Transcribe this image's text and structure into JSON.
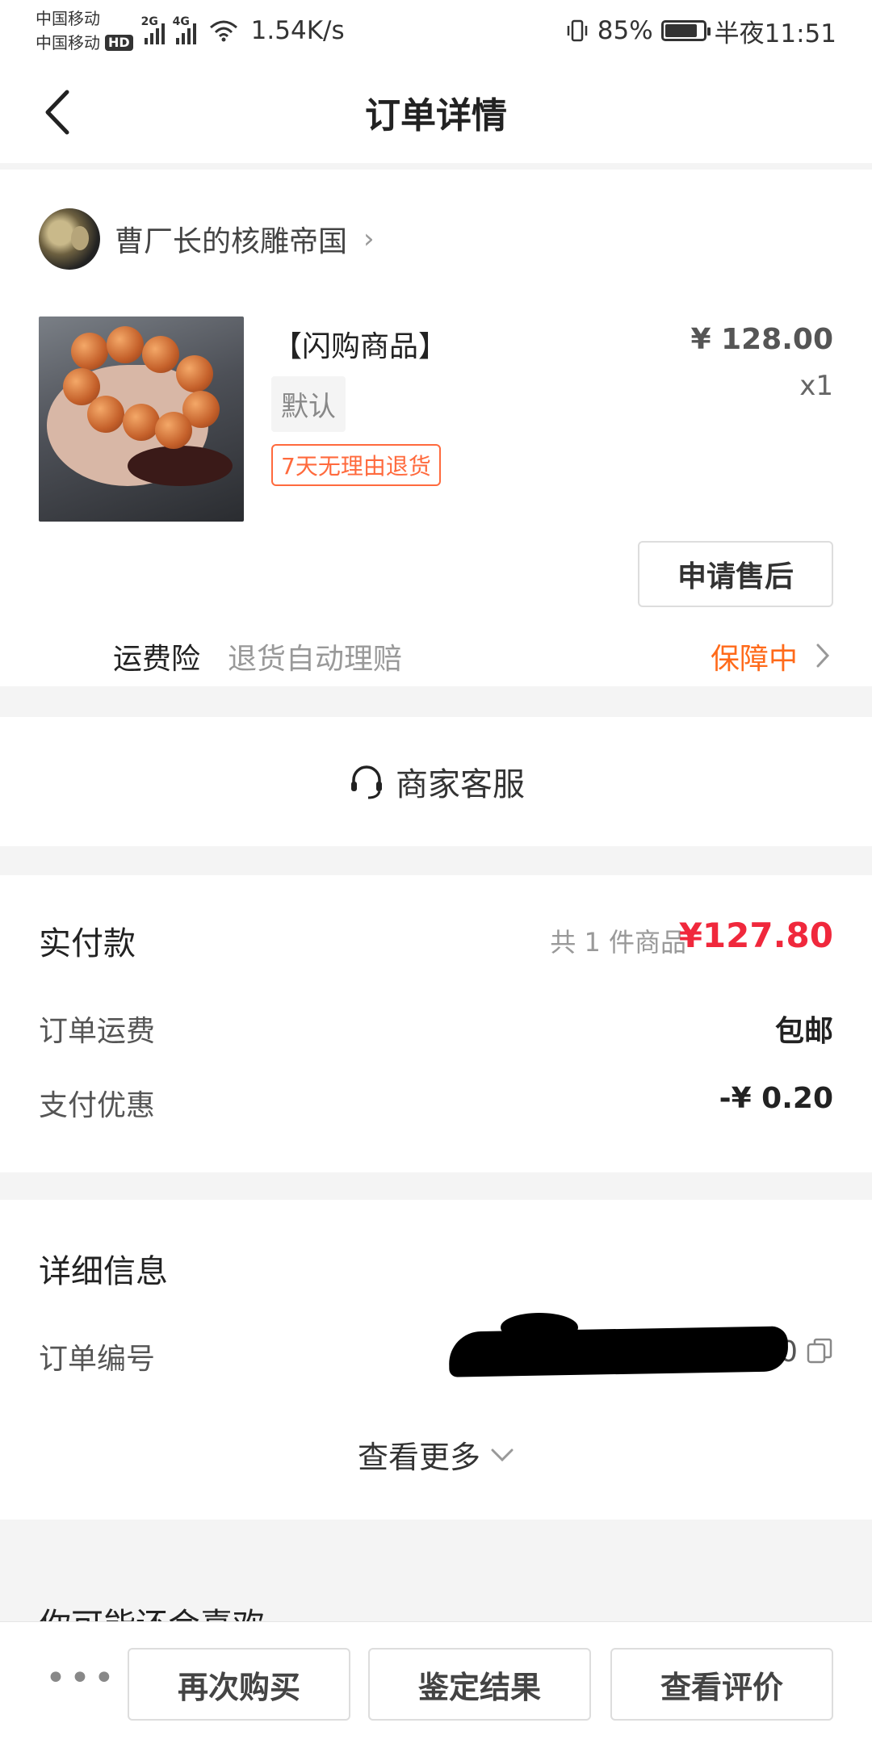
{
  "status_bar": {
    "carrier1": "中国移动",
    "carrier2": "中国移动",
    "hd": "HD",
    "net1": "2G",
    "net2": "4G",
    "speed": "1.54K/s",
    "battery": "85%",
    "battery_level": 0.85,
    "time": "半夜11:51"
  },
  "header": {
    "title": "订单详情"
  },
  "shop": {
    "name": "曹厂长的核雕帝国",
    "chevron": "›"
  },
  "product": {
    "title": "【闪购商品】",
    "sku": "默认",
    "return_tag": "7天无理由退货",
    "price": "¥ 128.00",
    "qty": "x1",
    "after_sale_label": "申请售后"
  },
  "insurance": {
    "label": "运费险",
    "desc": "退货自动理赔",
    "status": "保障中"
  },
  "customer_service": {
    "label": "商家客服"
  },
  "payment": {
    "title": "实付款",
    "count": "共 1 件商品",
    "total": "¥127.80",
    "shipping_label": "订单运费",
    "shipping_value": "包邮",
    "discount_label": "支付优惠",
    "discount_value": "-¥ 0.20"
  },
  "details": {
    "title": "详细信息",
    "order_no_label": "订单编号",
    "order_no_tail": "0",
    "more_label": "查看更多"
  },
  "recommend": {
    "title": "你可能还会喜欢"
  },
  "bottom": {
    "more": "•••",
    "buy_again": "再次购买",
    "appraisal": "鉴定结果",
    "review": "查看评价"
  },
  "colors": {
    "accent_red": "#f0283c",
    "accent_orange": "#ff6a1a"
  }
}
